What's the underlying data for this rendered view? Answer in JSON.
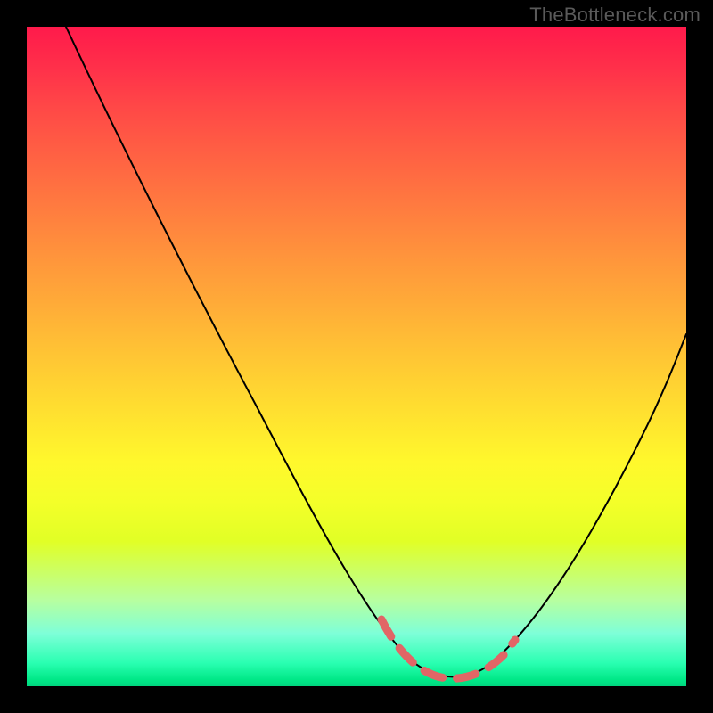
{
  "watermark": "TheBottleneck.com",
  "chart_data": {
    "type": "line",
    "title": "",
    "xlabel": "",
    "ylabel": "",
    "x_range": [
      0,
      100
    ],
    "y_range": [
      0,
      100
    ],
    "background": "gradient_green_to_red",
    "series": [
      {
        "name": "black-curve",
        "style": "solid",
        "points": [
          {
            "x": 6,
            "y": 100
          },
          {
            "x": 20,
            "y": 75
          },
          {
            "x": 35,
            "y": 48
          },
          {
            "x": 48,
            "y": 22
          },
          {
            "x": 56,
            "y": 8
          },
          {
            "x": 62,
            "y": 2
          },
          {
            "x": 68,
            "y": 2
          },
          {
            "x": 74,
            "y": 6
          },
          {
            "x": 82,
            "y": 20
          },
          {
            "x": 90,
            "y": 38
          },
          {
            "x": 98,
            "y": 55
          }
        ]
      },
      {
        "name": "highlight-dash",
        "style": "dashed",
        "color": "#e16666",
        "points": [
          {
            "x": 55,
            "y": 10
          },
          {
            "x": 60,
            "y": 3
          },
          {
            "x": 65,
            "y": 2
          },
          {
            "x": 70,
            "y": 2
          },
          {
            "x": 74,
            "y": 6
          }
        ]
      }
    ]
  }
}
